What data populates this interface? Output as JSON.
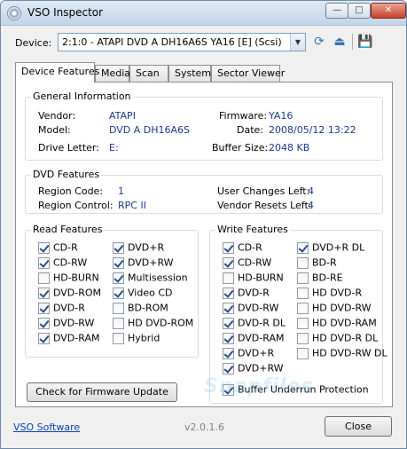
{
  "window": {
    "title": "VSO Inspector"
  },
  "device": {
    "label": "Device:",
    "selected": "2:1:0 - ATAPI DVD A  DH16A6S YA16 [E] (Scsi)"
  },
  "tabs": [
    {
      "label": "Device Features"
    },
    {
      "label": "Media"
    },
    {
      "label": "Scan"
    },
    {
      "label": "System"
    },
    {
      "label": "Sector Viewer"
    }
  ],
  "general": {
    "title": "General Information",
    "vendor_label": "Vendor:",
    "vendor": "ATAPI",
    "model_label": "Model:",
    "model": "DVD A  DH16A6S",
    "drive_letter_label": "Drive Letter:",
    "drive_letter": "E:",
    "firmware_label": "Firmware:",
    "firmware": "YA16",
    "date_label": "Date:",
    "date": "2008/05/12 13:22",
    "buffer_label": "Buffer Size:",
    "buffer": "2048 KB"
  },
  "dvd": {
    "title": "DVD Features",
    "region_code_label": "Region Code:",
    "region_code": "1",
    "region_control_label": "Region Control:",
    "region_control": "RPC II",
    "user_changes_label": "User Changes Left:",
    "user_changes": "4",
    "vendor_resets_label": "Vendor Resets Left:",
    "vendor_resets": "4"
  },
  "read": {
    "title": "Read Features",
    "col1": [
      {
        "label": "CD-R",
        "checked": true
      },
      {
        "label": "CD-RW",
        "checked": true
      },
      {
        "label": "HD-BURN",
        "checked": false
      },
      {
        "label": "DVD-ROM",
        "checked": true
      },
      {
        "label": "DVD-R",
        "checked": true
      },
      {
        "label": "DVD-RW",
        "checked": true
      },
      {
        "label": "DVD-RAM",
        "checked": true
      }
    ],
    "col2": [
      {
        "label": "DVD+R",
        "checked": true
      },
      {
        "label": "DVD+RW",
        "checked": true
      },
      {
        "label": "Multisession",
        "checked": true
      },
      {
        "label": "Video CD",
        "checked": true
      },
      {
        "label": "BD-ROM",
        "checked": false
      },
      {
        "label": "HD DVD-ROM",
        "checked": false
      },
      {
        "label": "Hybrid",
        "checked": false
      }
    ]
  },
  "write": {
    "title": "Write Features",
    "col1": [
      {
        "label": "CD-R",
        "checked": true
      },
      {
        "label": "CD-RW",
        "checked": true
      },
      {
        "label": "HD-BURN",
        "checked": false
      },
      {
        "label": "DVD-R",
        "checked": true
      },
      {
        "label": "DVD-RW",
        "checked": true
      },
      {
        "label": "DVD-R DL",
        "checked": true
      },
      {
        "label": "DVD-RAM",
        "checked": true
      },
      {
        "label": "DVD+R",
        "checked": true
      },
      {
        "label": "DVD+RW",
        "checked": true
      }
    ],
    "col2": [
      {
        "label": "DVD+R DL",
        "checked": true
      },
      {
        "label": "BD-R",
        "checked": false
      },
      {
        "label": "BD-RE",
        "checked": false
      },
      {
        "label": "HD DVD-R",
        "checked": false
      },
      {
        "label": "HD DVD-RW",
        "checked": false
      },
      {
        "label": "HD DVD-RAM",
        "checked": false
      },
      {
        "label": "HD DVD-R DL",
        "checked": false
      },
      {
        "label": "HD DVD-RW DL",
        "checked": false
      }
    ],
    "buffer_underrun": {
      "label": "Buffer Underrun Protection",
      "checked": true
    }
  },
  "firmware_button": "Check for Firmware Update",
  "watermark": "Snapfiles",
  "footer": {
    "link": "VSO Software",
    "version": "v2.0.1.6",
    "close": "Close"
  },
  "icons": {
    "refresh": "refresh-icon",
    "eject": "eject-icon",
    "save": "save-icon"
  }
}
